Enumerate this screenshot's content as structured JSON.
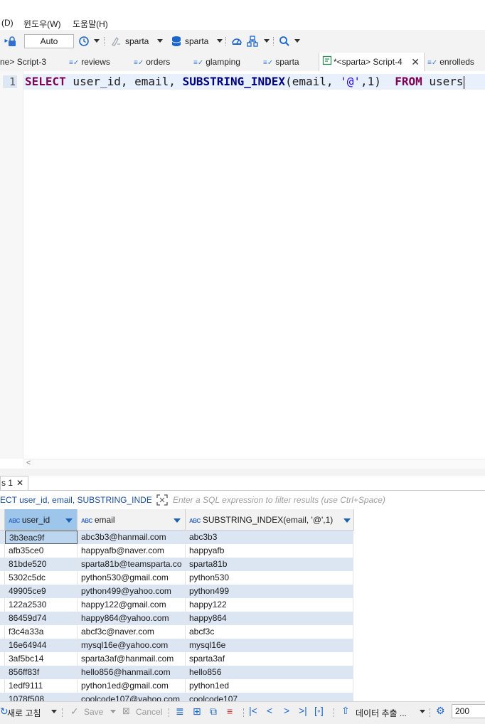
{
  "menu": {
    "items": [
      "(D)",
      "윈도우(W)",
      "도움말(H)"
    ]
  },
  "toolbar": {
    "transaction_mode": "Auto",
    "datasource": "sparta",
    "schema": "sparta"
  },
  "tabs": [
    {
      "label": "ne> Script-3",
      "icon": "none"
    },
    {
      "label": "reviews",
      "icon": "sql-table-icon"
    },
    {
      "label": "orders",
      "icon": "sql-table-icon"
    },
    {
      "label": "glamping",
      "icon": "sql-table-icon"
    },
    {
      "label": "sparta",
      "icon": "sql-table-icon"
    },
    {
      "label": "*<sparta> Script-4",
      "icon": "script-icon",
      "active": true
    },
    {
      "label": "enrolleds",
      "icon": "sql-table-icon"
    }
  ],
  "editor": {
    "line_number": "1",
    "code": {
      "kw_select": "SELECT",
      "part1": " user_id, email, ",
      "fn": "SUBSTRING_INDEX",
      "part2": "(email, ",
      "str": "'@'",
      "part3": ",1)  ",
      "kw_from": "FROM",
      "part4": " users"
    },
    "scroll_arrow": "<"
  },
  "results": {
    "tab_label": "s 1",
    "filter_query": "ECT user_id, email, SUBSTRING_INDEX(e",
    "filter_placeholder": "Enter a SQL expression to filter results (use Ctrl+Space)",
    "columns": [
      "user_id",
      "email",
      "SUBSTRING_INDEX(email, '@',1)"
    ],
    "rows": [
      [
        "3b3eac9f",
        "abc3b3@hanmail.com",
        "abc3b3"
      ],
      [
        "afb35ce0",
        "happyafb@naver.com",
        "happyafb"
      ],
      [
        "81bde520",
        "sparta81b@teamsparta.co",
        "sparta81b"
      ],
      [
        "5302c5dc",
        "python530@gmail.com",
        "python530"
      ],
      [
        "49905ce9",
        "python499@yahoo.com",
        "python499"
      ],
      [
        "122a2530",
        "happy122@gmail.com",
        "happy122"
      ],
      [
        "86459d74",
        "happy864@yahoo.com",
        "happy864"
      ],
      [
        "f3c4a33a",
        "abcf3c@naver.com",
        "abcf3c"
      ],
      [
        "16e64944",
        "mysql16e@yahoo.com",
        "mysql16e"
      ],
      [
        "3af5bc14",
        "sparta3af@hanmail.com",
        "sparta3af"
      ],
      [
        "856ff83f",
        "hello856@hanmail.com",
        "hello856"
      ],
      [
        "1edf9111",
        "python1ed@gmail.com",
        "python1ed"
      ],
      [
        "1078f508",
        "coolcode107@yahoo.com",
        "coolcode107"
      ]
    ]
  },
  "bottombar": {
    "refresh": "새로 고침",
    "save": "Save",
    "cancel": "Cancel",
    "export": "데이터 추출 ...",
    "limit": "200"
  }
}
